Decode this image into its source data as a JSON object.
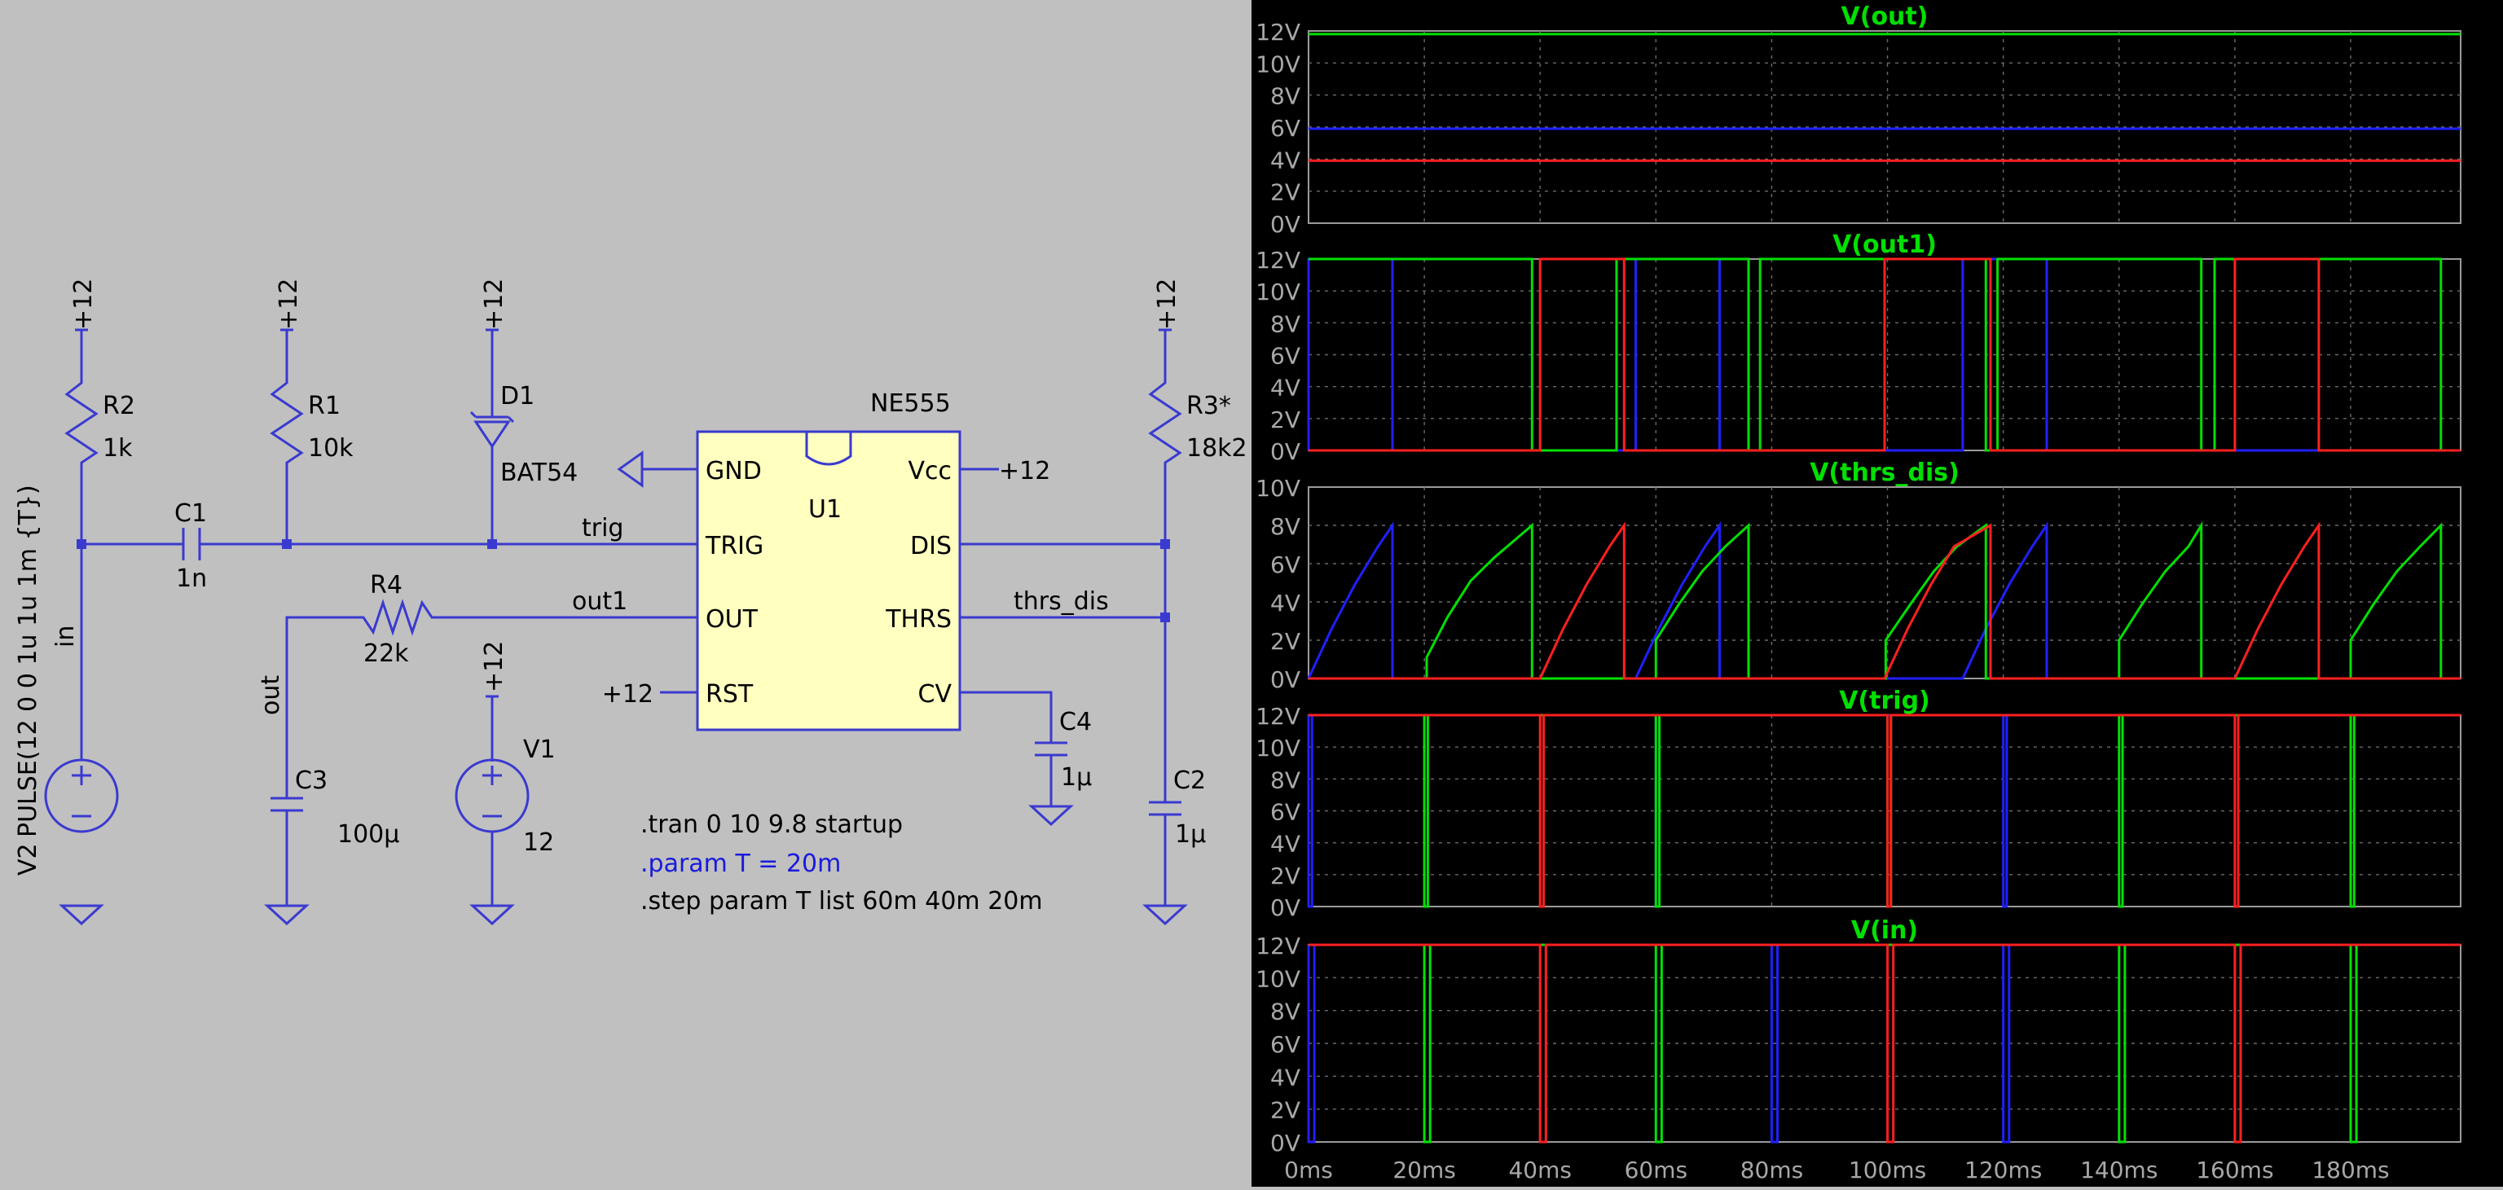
{
  "schematic": {
    "components": {
      "r2": {
        "ref": "R2",
        "value": "1k"
      },
      "r1": {
        "ref": "R1",
        "value": "10k"
      },
      "d1": {
        "ref": "D1",
        "value": "BAT54"
      },
      "r3": {
        "ref": "R3*",
        "value": "18k2"
      },
      "r4": {
        "ref": "R4",
        "value": "22k"
      },
      "c1": {
        "ref": "C1",
        "value": "1n"
      },
      "c2": {
        "ref": "C2",
        "value": "1µ"
      },
      "c3": {
        "ref": "C3",
        "value": "100µ"
      },
      "c4": {
        "ref": "C4",
        "value": "1µ"
      },
      "v1": {
        "ref": "V1",
        "value": "12"
      },
      "v2": {
        "ref": "V2",
        "value": "PULSE(12 0 0 1u 1u 1m {T})"
      }
    },
    "ic": {
      "part": "NE555",
      "ref": "U1",
      "pins": {
        "gnd": "GND",
        "trig": "TRIG",
        "out": "OUT",
        "rst": "RST",
        "vcc": "Vcc",
        "dis": "DIS",
        "thrs": "THRS",
        "cv": "CV"
      }
    },
    "supply_label": "+12",
    "nets": {
      "trig": "trig",
      "out1": "out1",
      "thrs_dis": "thrs_dis",
      "in": "in",
      "out": "out"
    },
    "directives": [
      ".tran 0 10 9.8 startup",
      ".param T = 20m",
      ".step param  T list 60m 40m 20m"
    ],
    "colors": {
      "wire": "#3a3ad0",
      "ic_fill": "#ffffc0",
      "directive": "#000000",
      "param": "#1a1adc"
    }
  },
  "plots": {
    "series_colors": [
      "#2020ff",
      "#00e000",
      "#ff2020"
    ],
    "step_T_ms": [
      60,
      40,
      20
    ],
    "x_axis": {
      "ticks": [
        "0ms",
        "20ms",
        "40ms",
        "60ms",
        "80ms",
        "100ms",
        "120ms",
        "140ms",
        "160ms",
        "180ms"
      ],
      "range_ms": [
        0,
        199
      ]
    },
    "panels": [
      {
        "title": "V(out)",
        "ylim": [
          0,
          12
        ],
        "ticks": [
          "0V",
          "2V",
          "4V",
          "6V",
          "8V",
          "10V",
          "12V"
        ]
      },
      {
        "title": "V(out1)",
        "ylim": [
          0,
          12
        ],
        "ticks": [
          "0V",
          "2V",
          "4V",
          "6V",
          "8V",
          "10V",
          "12V"
        ]
      },
      {
        "title": "V(thrs_dis)",
        "ylim": [
          0,
          10
        ],
        "ticks": [
          "0V",
          "2V",
          "4V",
          "6V",
          "8V",
          "10V"
        ]
      },
      {
        "title": "V(trig)",
        "ylim": [
          0,
          12
        ],
        "ticks": [
          "0V",
          "2V",
          "4V",
          "6V",
          "8V",
          "10V",
          "12V"
        ]
      },
      {
        "title": "V(in)",
        "ylim": [
          0,
          12
        ],
        "ticks": [
          "0V",
          "2V",
          "4V",
          "6V",
          "8V",
          "10V",
          "12V"
        ]
      }
    ]
  },
  "chart_data": [
    {
      "type": "line",
      "title": "V(out)",
      "x_unit": "ms",
      "ylim": [
        0,
        12
      ],
      "grid": true,
      "series": [
        {
          "color": "#00e000",
          "x": [
            0,
            199
          ],
          "values": [
            11.8,
            11.8
          ]
        },
        {
          "color": "#2020ff",
          "x": [
            0,
            199
          ],
          "values": [
            5.9,
            5.9
          ]
        },
        {
          "color": "#ff2020",
          "x": [
            0,
            199
          ],
          "values": [
            3.9,
            3.9
          ]
        }
      ]
    },
    {
      "type": "line",
      "title": "V(out1)",
      "x_unit": "ms",
      "ylim": [
        0,
        12
      ],
      "grid": true,
      "series": [
        {
          "color": "#2020ff",
          "x": [
            0,
            0,
            14.5,
            14.5,
            56.5,
            56.5,
            71,
            71,
            113,
            113,
            127.5,
            127.5,
            199
          ],
          "values": [
            0,
            12,
            12,
            0,
            0,
            12,
            12,
            0,
            0,
            12,
            12,
            0,
            0
          ]
        },
        {
          "color": "#00e000",
          "x": [
            0,
            38.6,
            38.6,
            53.2,
            53.2,
            76,
            76,
            78,
            78,
            117,
            117,
            119,
            119,
            154.2,
            154.2,
            156.5,
            156.5,
            195.6,
            195.6,
            199
          ],
          "values": [
            12,
            12,
            0,
            0,
            12,
            12,
            0,
            0,
            12,
            12,
            0,
            0,
            12,
            12,
            0,
            0,
            12,
            12,
            0,
            0
          ]
        },
        {
          "color": "#ff2020",
          "x": [
            0,
            40,
            40,
            54.5,
            54.5,
            99.5,
            99.5,
            117.8,
            117.8,
            160,
            160,
            174.5,
            174.5,
            199
          ],
          "values": [
            0,
            0,
            12,
            12,
            0,
            0,
            12,
            12,
            0,
            0,
            12,
            12,
            0,
            0
          ]
        }
      ]
    },
    {
      "type": "line",
      "title": "V(thrs_dis)",
      "x_unit": "ms",
      "ylim": [
        0,
        10
      ],
      "grid": true,
      "series": [
        {
          "color": "#2020ff",
          "name": "",
          "x": [
            0,
            4,
            8,
            12,
            14.5,
            14.5,
            56.5,
            60.5,
            64.5,
            68.5,
            71,
            71,
            113,
            117,
            121,
            125,
            127.5,
            127.5,
            199
          ],
          "values": [
            0,
            2.6,
            4.9,
            6.9,
            8,
            0,
            0,
            2.6,
            4.9,
            6.9,
            8,
            0,
            0,
            2.6,
            4.9,
            6.9,
            8,
            0,
            0
          ]
        },
        {
          "color": "#00e000",
          "x": [
            0,
            20.4,
            20.4,
            24,
            28,
            32,
            38.6,
            38.6,
            60,
            60,
            64,
            68,
            72,
            76,
            76,
            99.7,
            99.7,
            104,
            108,
            112,
            117,
            117,
            140,
            140,
            144,
            148,
            152,
            154.2,
            154.2,
            180,
            180,
            184,
            188,
            192,
            195.6,
            195.6,
            199
          ],
          "values": [
            0,
            0,
            1.1,
            3.2,
            5.1,
            6.3,
            8,
            0,
            0,
            2,
            3.9,
            5.6,
            6.9,
            8,
            0,
            0,
            2,
            3.9,
            5.6,
            6.9,
            8,
            0,
            0,
            2,
            3.9,
            5.6,
            6.9,
            8,
            0,
            0,
            2,
            3.9,
            5.6,
            6.9,
            8,
            0,
            0
          ]
        },
        {
          "color": "#ff2020",
          "x": [
            0,
            40,
            44,
            48,
            52,
            54.5,
            54.5,
            99.5,
            103.5,
            107.5,
            111.5,
            117.8,
            117.8,
            160,
            164,
            168,
            172,
            174.5,
            174.5,
            199
          ],
          "values": [
            0,
            0,
            2.6,
            4.9,
            6.9,
            8,
            0,
            0,
            2.6,
            4.9,
            6.9,
            8,
            0,
            0,
            2.6,
            4.9,
            6.9,
            8,
            0,
            0
          ]
        }
      ]
    },
    {
      "type": "line",
      "title": "V(trig)",
      "x_unit": "ms",
      "ylim": [
        0,
        12
      ],
      "grid": true,
      "series": [
        {
          "color": "#2020ff",
          "x": [
            0,
            0,
            0.6,
            0.6,
            60,
            60,
            60.6,
            60.6,
            120,
            120,
            120.6,
            120.6,
            199
          ],
          "values": [
            12,
            0,
            0,
            12,
            12,
            0,
            0,
            12,
            12,
            0,
            0,
            12,
            12
          ]
        },
        {
          "color": "#00e000",
          "x": [
            0,
            20,
            20,
            20.6,
            20.6,
            60,
            60,
            60.6,
            60.6,
            100,
            100,
            100.6,
            100.6,
            140,
            140,
            140.6,
            140.6,
            180,
            180,
            180.6,
            180.6,
            199
          ],
          "values": [
            12,
            12,
            0,
            0,
            12,
            12,
            0,
            0,
            12,
            12,
            0,
            0,
            12,
            12,
            0,
            0,
            12,
            12,
            0,
            0,
            12,
            12
          ]
        },
        {
          "color": "#ff2020",
          "x": [
            0,
            40,
            40,
            40.6,
            40.6,
            100,
            100,
            100.6,
            100.6,
            160,
            160,
            160.6,
            160.6,
            199
          ],
          "values": [
            12,
            12,
            0,
            0,
            12,
            12,
            0,
            0,
            12,
            12,
            0,
            0,
            12,
            12
          ]
        }
      ]
    },
    {
      "type": "line",
      "title": "V(in)",
      "x_unit": "ms",
      "ylim": [
        0,
        12
      ],
      "grid": true,
      "series": [
        {
          "color": "#2020ff",
          "x": [
            0,
            0,
            1,
            1,
            80,
            80,
            81,
            81,
            120,
            120,
            121,
            121,
            199
          ],
          "values": [
            12,
            0,
            0,
            12,
            12,
            0,
            0,
            12,
            12,
            0,
            0,
            12,
            12
          ]
        },
        {
          "color": "#00e000",
          "x": [
            0,
            20,
            20,
            21,
            21,
            60,
            60,
            61,
            61,
            140,
            140,
            141,
            141,
            180,
            180,
            181,
            181,
            199
          ],
          "values": [
            12,
            12,
            0,
            0,
            12,
            12,
            0,
            0,
            12,
            12,
            0,
            0,
            12,
            12,
            0,
            0,
            12,
            12
          ]
        },
        {
          "color": "#ff2020",
          "x": [
            0,
            40,
            40,
            41,
            41,
            100,
            100,
            101,
            101,
            160,
            160,
            161,
            161,
            199
          ],
          "values": [
            12,
            12,
            0,
            0,
            12,
            12,
            0,
            0,
            12,
            12,
            0,
            0,
            12,
            12
          ]
        }
      ]
    }
  ]
}
